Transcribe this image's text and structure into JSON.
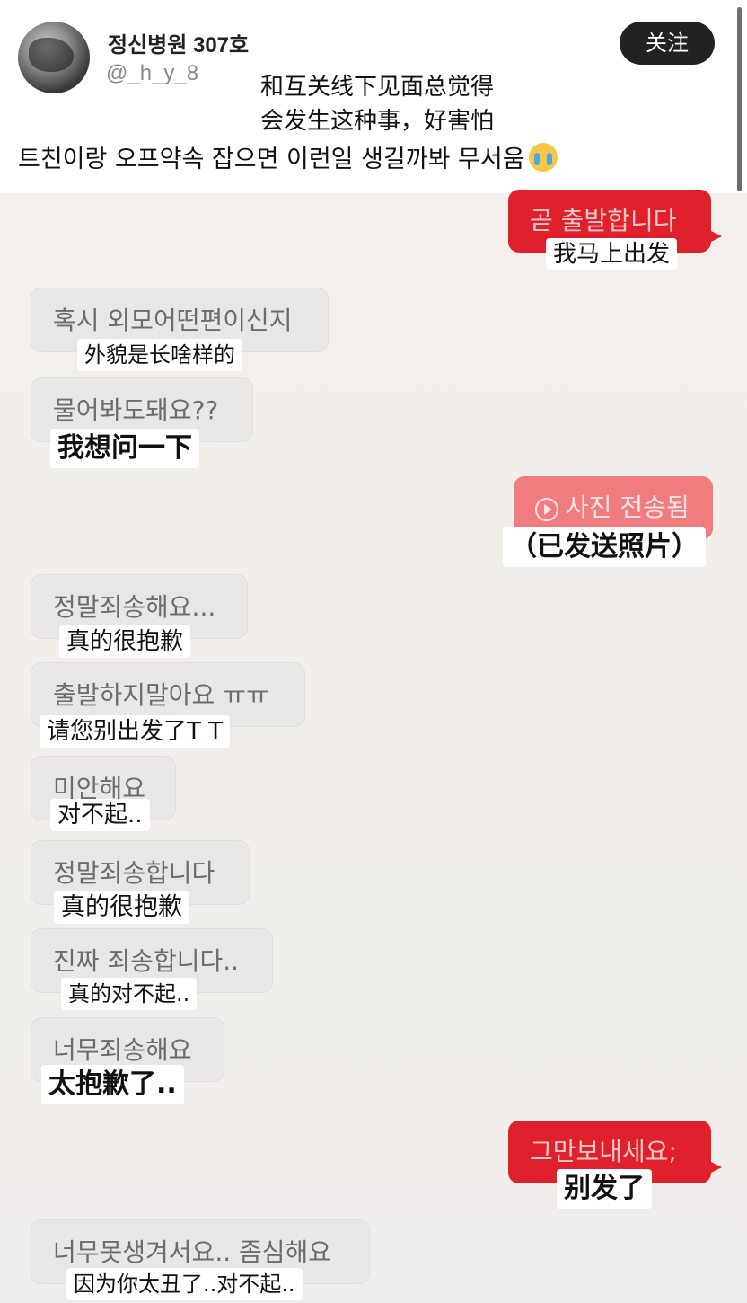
{
  "header": {
    "username": "정신병원 307호",
    "handle": "@_h_y_8",
    "follow_label": "关注",
    "caption_zh_line1": "和互关线下见面总觉得",
    "caption_zh_line2": "会发生这种事，好害怕",
    "caption_ko": "트친이랑 오프약속 잡으면 이런일 생길까봐 무서움",
    "caption_emoji": "loudly-crying-face-icon"
  },
  "messages": [
    {
      "side": "out",
      "text": "곧 출발합니다",
      "translation": "我马上出发"
    },
    {
      "side": "in",
      "text": "혹시 외모어떤편이신지",
      "translation": "外貌是长啥样的"
    },
    {
      "side": "in",
      "text": "물어봐도돼요??",
      "translation": "我想问一下"
    },
    {
      "side": "out",
      "text": "사진 전송됨",
      "translation": "（已发送照片）"
    },
    {
      "side": "in",
      "text": "정말죄송해요...",
      "translation": "真的很抱歉"
    },
    {
      "side": "in",
      "text": "출발하지말아요 ㅠㅠ",
      "translation": "请您别出发了T T"
    },
    {
      "side": "in",
      "text": "미안해요",
      "translation": "对不起.."
    },
    {
      "side": "in",
      "text": "정말죄송합니다",
      "translation": "真的很抱歉"
    },
    {
      "side": "in",
      "text": "진짜 죄송합니다..",
      "translation": "真的对不起.."
    },
    {
      "side": "in",
      "text": "너무죄송해요",
      "translation": "太抱歉了.."
    },
    {
      "side": "out",
      "text": "그만보내세요;",
      "translation": "别发了"
    },
    {
      "side": "in",
      "text": "너무못생겨서요.. 좀심해요",
      "translation": "因为你太丑了..对不起.."
    }
  ],
  "colors": {
    "outgoing_bubble": "#e0202a",
    "incoming_bubble": "#e9e7e6",
    "follow_button": "#222222"
  }
}
